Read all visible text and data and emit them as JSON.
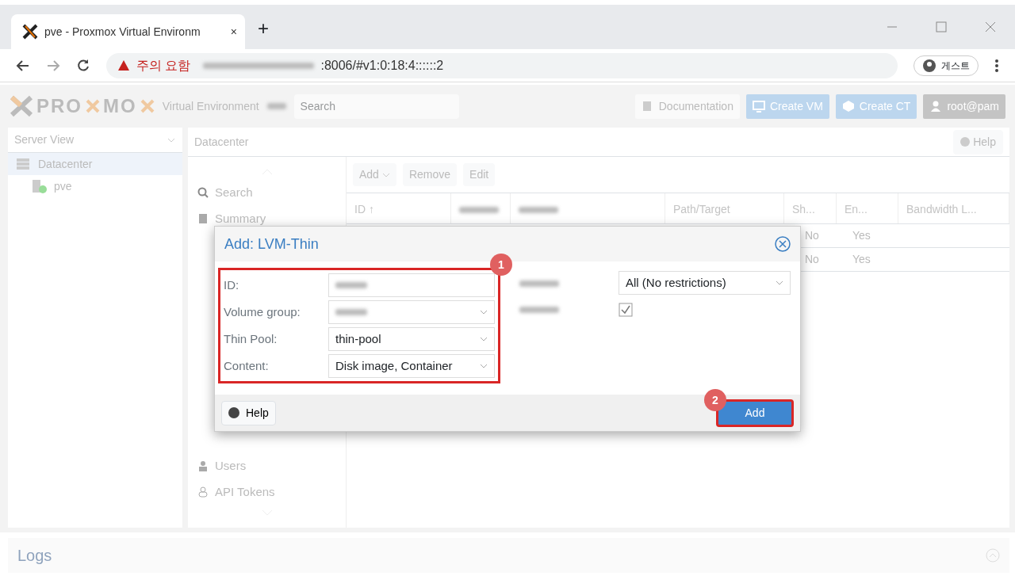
{
  "browser": {
    "tab_title": "pve - Proxmox Virtual Environm",
    "tab_close": "×",
    "new_tab": "+",
    "warning": "주의 요함",
    "url": ":8006/#v1:0:18:4::::::2",
    "profile": "게스트"
  },
  "header": {
    "brand_a": "PRO",
    "brand_b": "MO",
    "product": "Virtual Environment",
    "search_placeholder": "Search",
    "buttons": [
      {
        "label": "Documentation",
        "kind": "doc"
      },
      {
        "label": "Create VM",
        "kind": "vm"
      },
      {
        "label": "Create CT",
        "kind": "ct"
      },
      {
        "label": "root@pam",
        "kind": "user"
      }
    ]
  },
  "tree": {
    "view": "Server View",
    "items": [
      {
        "label": "Datacenter",
        "selected": true,
        "children": [
          {
            "label": "pve",
            "selected": false
          }
        ]
      }
    ]
  },
  "panel": {
    "title": "Datacenter",
    "help": "Help"
  },
  "menu": [
    {
      "label": "Search",
      "kind": "search"
    },
    {
      "label": "Summary",
      "kind": "summary"
    },
    {
      "label": "Users",
      "kind": "user"
    },
    {
      "label": "API Tokens",
      "kind": "token"
    }
  ],
  "toolbar": [
    {
      "label": "Add",
      "dropdown": true
    },
    {
      "label": "Remove",
      "dropdown": false
    },
    {
      "label": "Edit",
      "dropdown": false
    }
  ],
  "table": {
    "columns": [
      {
        "label": "ID ↑",
        "redacted": false
      },
      {
        "redacted": true
      },
      {
        "redacted": true
      },
      {
        "label": "Path/Target",
        "redacted": false
      },
      {
        "label": "Sh...",
        "redacted": false
      },
      {
        "label": "En...",
        "redacted": false
      },
      {
        "label": "Bandwidth L...",
        "redacted": false
      }
    ],
    "rows": [
      {
        "shared": "No",
        "enabled": "Yes"
      },
      {
        "shared": "No",
        "enabled": "Yes"
      }
    ]
  },
  "dialog": {
    "title": "Add: LVM-Thin",
    "fields": [
      {
        "label": "ID:",
        "kind": "text",
        "redacted": true
      },
      {
        "label": "Volume group:",
        "kind": "select",
        "redacted": true
      },
      {
        "label": "Thin Pool:",
        "kind": "select",
        "value": "thin-pool",
        "redacted": false
      },
      {
        "label": "Content:",
        "kind": "select",
        "value": "Disk image, Container",
        "redacted": false
      }
    ],
    "right_fields": [
      {
        "kind": "select",
        "value": "All (No restrictions)"
      },
      {
        "kind": "checkbox",
        "checked": true
      }
    ],
    "help": "Help",
    "submit": "Add",
    "markers": [
      "1",
      "2"
    ]
  },
  "logs": "Logs"
}
